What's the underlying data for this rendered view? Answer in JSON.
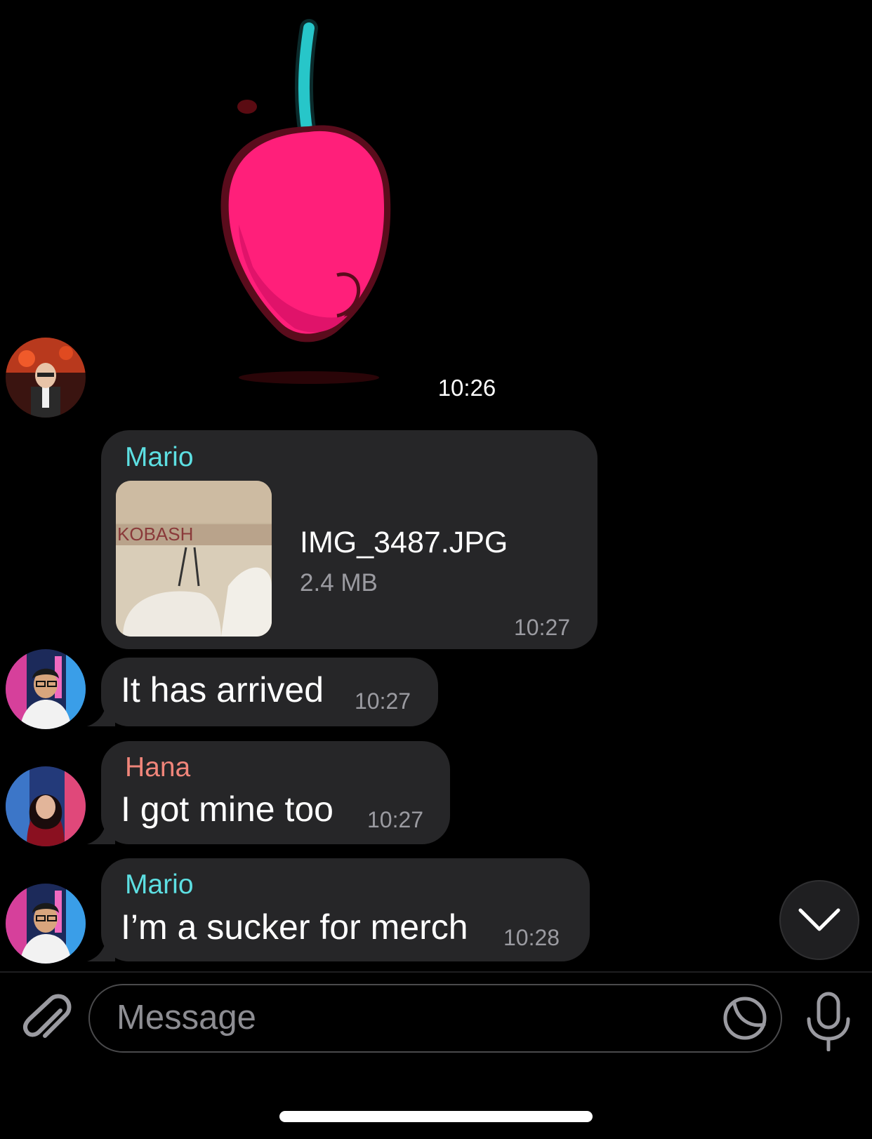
{
  "sticker": {
    "name": "cherry-sticker",
    "time": "10:26"
  },
  "messages": [
    {
      "sender": "Mario",
      "file": {
        "name": "IMG_3487.JPG",
        "size": "2.4 MB",
        "thumb_text": "KOBASH"
      },
      "time": "10:27"
    },
    {
      "text": "It has arrived",
      "time": "10:27"
    },
    {
      "sender": "Hana",
      "text": "I got mine too",
      "time": "10:27"
    },
    {
      "sender": "Mario",
      "text": "I’m a sucker for merch",
      "time": "10:28"
    }
  ],
  "composer": {
    "placeholder": "Message"
  },
  "colors": {
    "mario": "#5ddfe2",
    "hana": "#f0857a",
    "bubble": "#262628",
    "cherry": "#ff1f7a",
    "stem": "#27c6c9"
  }
}
